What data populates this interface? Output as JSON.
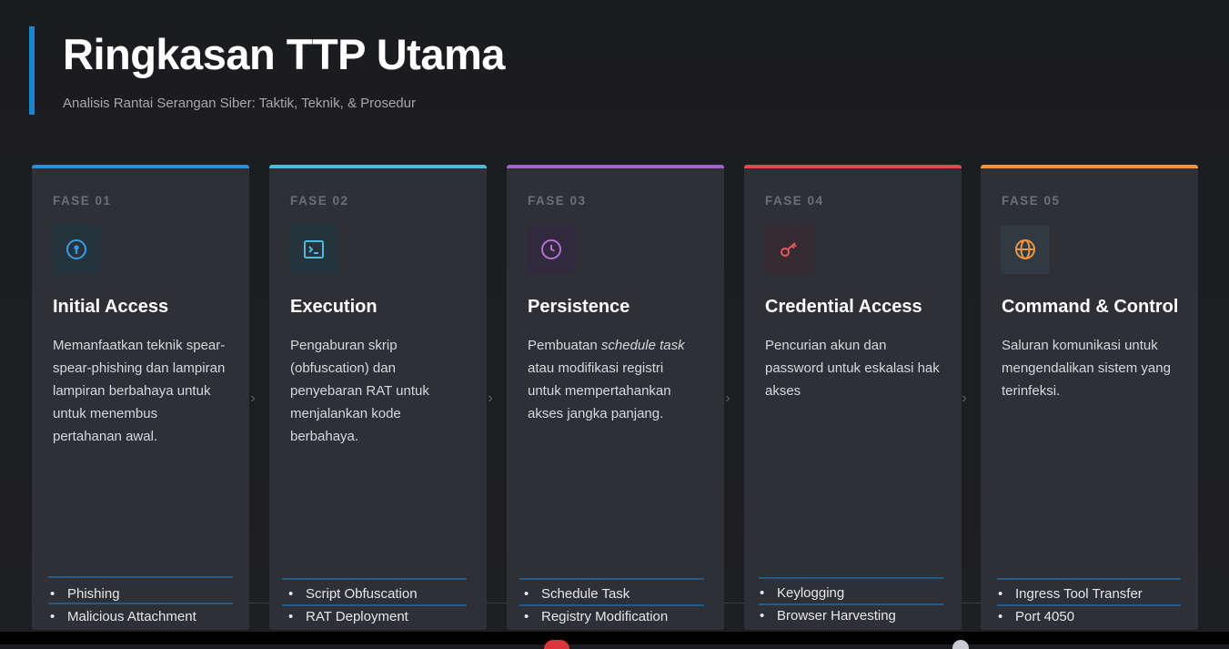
{
  "header": {
    "title": "Ringkasan TTP Utama",
    "subtitle": "Analisis Rantai Serangan Siber: Taktik, Teknik, & Prosedur"
  },
  "colors": {
    "accent": "#2382c8",
    "phase1": "#2f8ed4",
    "phase2": "#4fb7e0",
    "phase3": "#a660c9",
    "phase4": "#e04a4a",
    "phase5": "#ef9440"
  },
  "phases": [
    {
      "phase": "FASE 01",
      "icon": "keyhole-icon",
      "title": "Initial Access",
      "desc_lines": [
        "Memanfaatkan teknik spear-",
        "spear-phishing dan lampiran",
        "lampiran berbahaya untuk",
        "untuk menembus",
        "pertahanan awal."
      ],
      "items": [
        "Phishing",
        "Malicious Attachment"
      ]
    },
    {
      "phase": "FASE 02",
      "icon": "terminal-icon",
      "title": "Execution",
      "desc_lines": [
        "Pengaburan skrip",
        "(obfuscation) dan",
        "penyebaran RAT untuk",
        "menjalankan kode",
        "berbahaya."
      ],
      "items": [
        "Script Obfuscation",
        "RAT Deployment"
      ]
    },
    {
      "phase": "FASE 03",
      "icon": "clock-icon",
      "title": "Persistence",
      "desc_prefix": "Pembuatan ",
      "desc_em": "schedule task",
      "desc_lines": [
        "atau modifikasi registri",
        "untuk mempertahankan",
        "akses jangka panjang."
      ],
      "items": [
        "Schedule Task",
        "Registry Modification"
      ]
    },
    {
      "phase": "FASE 04",
      "icon": "key-icon",
      "title": "Credential Access",
      "desc_lines": [
        "Pencurian akun dan",
        "password untuk eskalasi hak",
        "akses"
      ],
      "items": [
        "Keylogging",
        "Browser Harvesting"
      ]
    },
    {
      "phase": "FASE 05",
      "icon": "globe-icon",
      "title": "Command & Control",
      "desc_lines": [
        "Saluran komunikasi untuk",
        "mengendalikan sistem yang",
        "terinfeksi."
      ],
      "items": [
        "Ingress Tool Transfer",
        "Port 4050"
      ]
    }
  ],
  "chevron_glyph": "›"
}
